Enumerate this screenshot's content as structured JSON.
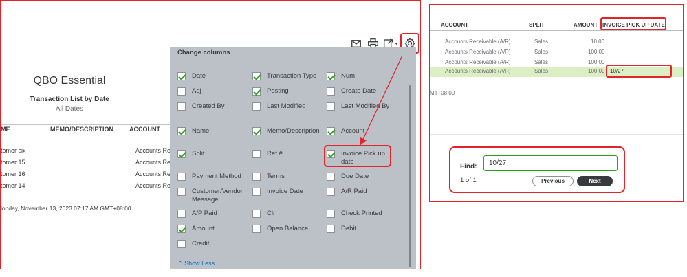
{
  "report": {
    "company": "QBO Essential",
    "title": "Transaction List by Date",
    "subtitle": "All Dates",
    "columns": [
      "ME",
      "MEMO/DESCRIPTION",
      "ACCOUNT"
    ],
    "rows": [
      {
        "name": "tomer six",
        "account": "Accounts Re"
      },
      {
        "name": "tomer 15",
        "account": "Accounts Re"
      },
      {
        "name": "tomer 16",
        "account": "Accounts Re"
      },
      {
        "name": "tomer 14",
        "account": "Accounts Re"
      }
    ],
    "footer": "londay, November 13, 2023   07:17 AM GMT+08:00"
  },
  "toolbar": {
    "icons": [
      "email-icon",
      "print-icon",
      "export-icon",
      "gear-icon"
    ]
  },
  "change_columns": {
    "title": "Change columns",
    "items": [
      {
        "label": "Date",
        "checked": true
      },
      {
        "label": "Transaction Type",
        "checked": true
      },
      {
        "label": "Num",
        "checked": true
      },
      {
        "label": "Adj",
        "checked": false
      },
      {
        "label": "Posting",
        "checked": true
      },
      {
        "label": "Create Date",
        "checked": false
      },
      {
        "label": "Created By",
        "checked": false
      },
      {
        "label": "Last Modified",
        "checked": false
      },
      {
        "label": "Last Modified By",
        "checked": false
      },
      {
        "label": "Name",
        "checked": true
      },
      {
        "label": "Memo/Description",
        "checked": true
      },
      {
        "label": "Account",
        "checked": true
      },
      {
        "label": "Split",
        "checked": true
      },
      {
        "label": "Ref #",
        "checked": false
      },
      {
        "label": "Invoice Pick up date",
        "checked": true
      },
      {
        "label": "Payment Method",
        "checked": false
      },
      {
        "label": "Terms",
        "checked": false
      },
      {
        "label": "Due Date",
        "checked": false
      },
      {
        "label": "Customer/Vendor Message",
        "checked": false
      },
      {
        "label": "Invoice Date",
        "checked": false
      },
      {
        "label": "A/R Paid",
        "checked": false
      },
      {
        "label": "A/P Paid",
        "checked": false
      },
      {
        "label": "Clr",
        "checked": false
      },
      {
        "label": "Check Printed",
        "checked": false
      },
      {
        "label": "Amount",
        "checked": true
      },
      {
        "label": "Open Balance",
        "checked": false
      },
      {
        "label": "Debit",
        "checked": false
      },
      {
        "label": "Credit",
        "checked": false
      }
    ],
    "show_less": "Show Less"
  },
  "right_report": {
    "columns": [
      "ACCOUNT",
      "SPLIT",
      "AMOUNT",
      "INVOICE PICK UP DATE"
    ],
    "rows": [
      {
        "account": "Accounts Receivable (A/R)",
        "split": "Sales",
        "amount": "10.00",
        "date": ""
      },
      {
        "account": "Accounts Receivable (A/R)",
        "split": "Sales",
        "amount": "100.00",
        "date": ""
      },
      {
        "account": "Accounts Receivable (A/R)",
        "split": "Sales",
        "amount": "100.00",
        "date": ""
      },
      {
        "account": "Accounts Receivable (A/R)",
        "split": "Sales",
        "amount": "100.00",
        "date": "10/27"
      }
    ],
    "timezone": "MT+08:00"
  },
  "find": {
    "label": "Find:",
    "value": "10/27",
    "count": "1 of 1",
    "previous_label": "Previous",
    "next_label": "Next"
  },
  "colors": {
    "highlight": "#e0262b",
    "check": "#2ca01c",
    "row_highlight": "#dcefc4"
  }
}
